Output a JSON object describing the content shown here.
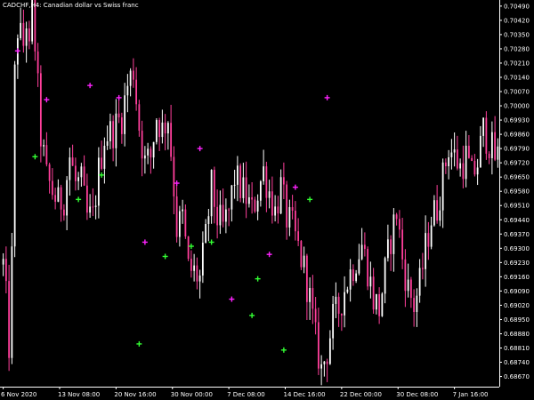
{
  "window": {
    "title": "CADCHF,H4:  Canadian dollar vs Swiss franc"
  },
  "colors": {
    "background": "#000000",
    "axis": "#ffffff",
    "bull_candle": "#ffffff",
    "bear_candle": "#ff3f9b",
    "buy_marker": "#33ff33",
    "sell_marker": "#ff22ff"
  },
  "chart_data": {
    "type": "candlestick",
    "title": "CADCHF,H4:  Canadian dollar vs Swiss franc",
    "ylim": [
      0.6862,
      0.7052
    ],
    "y_ticks": [
      "0.70490",
      "0.70420",
      "0.70350",
      "0.70280",
      "0.70210",
      "0.70140",
      "0.70070",
      "0.70000",
      "0.69930",
      "0.69860",
      "0.69790",
      "0.69720",
      "0.69650",
      "0.69580",
      "0.69510",
      "0.69440",
      "0.69370",
      "0.69300",
      "0.69230",
      "0.69160",
      "0.69090",
      "0.69020",
      "0.68950",
      "0.68880",
      "0.68810",
      "0.68740",
      "0.68670"
    ],
    "x_ticks": [
      "6 Nov 2020",
      "13 Nov 08:00",
      "20 Nov 16:00",
      "30 Nov 00:00",
      "7 Dec 08:00",
      "14 Dec 16:00",
      "22 Dec 00:00",
      "30 Dec 08:00",
      "7 Jan 16:00"
    ],
    "price_path": [
      [
        0,
        0.6922
      ],
      [
        1,
        0.6905
      ],
      [
        2,
        0.6882
      ],
      [
        3,
        0.6925
      ],
      [
        4,
        0.7015
      ],
      [
        5,
        0.7038
      ],
      [
        7,
        0.703
      ],
      [
        8,
        0.7042
      ],
      [
        9,
        0.7025
      ],
      [
        10,
        0.7048
      ],
      [
        11,
        0.703
      ],
      [
        13,
        0.6985
      ],
      [
        15,
        0.6965
      ],
      [
        17,
        0.6958
      ],
      [
        19,
        0.6952
      ],
      [
        21,
        0.6955
      ],
      [
        23,
        0.6975
      ],
      [
        25,
        0.6962
      ],
      [
        27,
        0.6962
      ],
      [
        29,
        0.6945
      ],
      [
        31,
        0.6945
      ],
      [
        33,
        0.6968
      ],
      [
        35,
        0.6985
      ],
      [
        38,
        0.6988
      ],
      [
        41,
        0.6995
      ],
      [
        43,
        0.701
      ],
      [
        45,
        0.7018
      ],
      [
        47,
        0.699
      ],
      [
        49,
        0.6972
      ],
      [
        51,
        0.6975
      ],
      [
        53,
        0.6995
      ],
      [
        55,
        0.6988
      ],
      [
        57,
        0.6995
      ],
      [
        59,
        0.696
      ],
      [
        60,
        0.694
      ],
      [
        62,
        0.6945
      ],
      [
        64,
        0.692
      ],
      [
        66,
        0.6918
      ],
      [
        68,
        0.6915
      ],
      [
        70,
        0.6935
      ],
      [
        72,
        0.696
      ],
      [
        74,
        0.6945
      ],
      [
        76,
        0.694
      ],
      [
        78,
        0.6948
      ],
      [
        80,
        0.6965
      ],
      [
        82,
        0.696
      ],
      [
        84,
        0.6955
      ],
      [
        86,
        0.6948
      ],
      [
        88,
        0.6958
      ],
      [
        90,
        0.6968
      ],
      [
        92,
        0.6958
      ],
      [
        94,
        0.6948
      ],
      [
        96,
        0.696
      ],
      [
        98,
        0.6945
      ],
      [
        100,
        0.694
      ],
      [
        102,
        0.693
      ],
      [
        104,
        0.692
      ],
      [
        106,
        0.6905
      ],
      [
        108,
        0.6885
      ],
      [
        110,
        0.687
      ],
      [
        112,
        0.688
      ],
      [
        114,
        0.6895
      ],
      [
        116,
        0.69
      ],
      [
        118,
        0.691
      ],
      [
        120,
        0.6918
      ],
      [
        122,
        0.6925
      ],
      [
        124,
        0.6932
      ],
      [
        126,
        0.692
      ],
      [
        128,
        0.6905
      ],
      [
        130,
        0.69
      ],
      [
        132,
        0.6918
      ],
      [
        134,
        0.6935
      ],
      [
        136,
        0.6948
      ],
      [
        138,
        0.6925
      ],
      [
        140,
        0.691
      ],
      [
        142,
        0.6902
      ],
      [
        144,
        0.6912
      ],
      [
        146,
        0.693
      ],
      [
        148,
        0.6945
      ],
      [
        150,
        0.695
      ],
      [
        152,
        0.6965
      ],
      [
        154,
        0.698
      ],
      [
        156,
        0.6975
      ],
      [
        158,
        0.697
      ],
      [
        160,
        0.6975
      ],
      [
        162,
        0.6965
      ],
      [
        164,
        0.6972
      ],
      [
        166,
        0.6988
      ],
      [
        168,
        0.6982
      ],
      [
        170,
        0.6975
      ]
    ],
    "signals": [
      {
        "type": "sell",
        "bar": 5,
        "price": 0.7027
      },
      {
        "type": "buy",
        "bar": 11,
        "price": 0.6975
      },
      {
        "type": "sell",
        "bar": 15,
        "price": 0.7003
      },
      {
        "type": "buy",
        "bar": 26,
        "price": 0.6954
      },
      {
        "type": "sell",
        "bar": 30,
        "price": 0.701
      },
      {
        "type": "buy",
        "bar": 34,
        "price": 0.6966
      },
      {
        "type": "sell",
        "bar": 40,
        "price": 0.7004
      },
      {
        "type": "buy",
        "bar": 47,
        "price": 0.6883
      },
      {
        "type": "sell",
        "bar": 49,
        "price": 0.6933
      },
      {
        "type": "buy",
        "bar": 56,
        "price": 0.6926
      },
      {
        "type": "sell",
        "bar": 60,
        "price": 0.6962
      },
      {
        "type": "buy",
        "bar": 65,
        "price": 0.6931
      },
      {
        "type": "sell",
        "bar": 68,
        "price": 0.6979
      },
      {
        "type": "buy",
        "bar": 72,
        "price": 0.6933
      },
      {
        "type": "sell",
        "bar": 79,
        "price": 0.6905
      },
      {
        "type": "buy",
        "bar": 86,
        "price": 0.6897
      },
      {
        "type": "buy",
        "bar": 88,
        "price": 0.6915
      },
      {
        "type": "sell",
        "bar": 92,
        "price": 0.6927
      },
      {
        "type": "buy",
        "bar": 97,
        "price": 0.688
      },
      {
        "type": "sell",
        "bar": 101,
        "price": 0.696
      },
      {
        "type": "buy",
        "bar": 106,
        "price": 0.6954
      },
      {
        "type": "sell",
        "bar": 112,
        "price": 0.7004
      }
    ]
  }
}
